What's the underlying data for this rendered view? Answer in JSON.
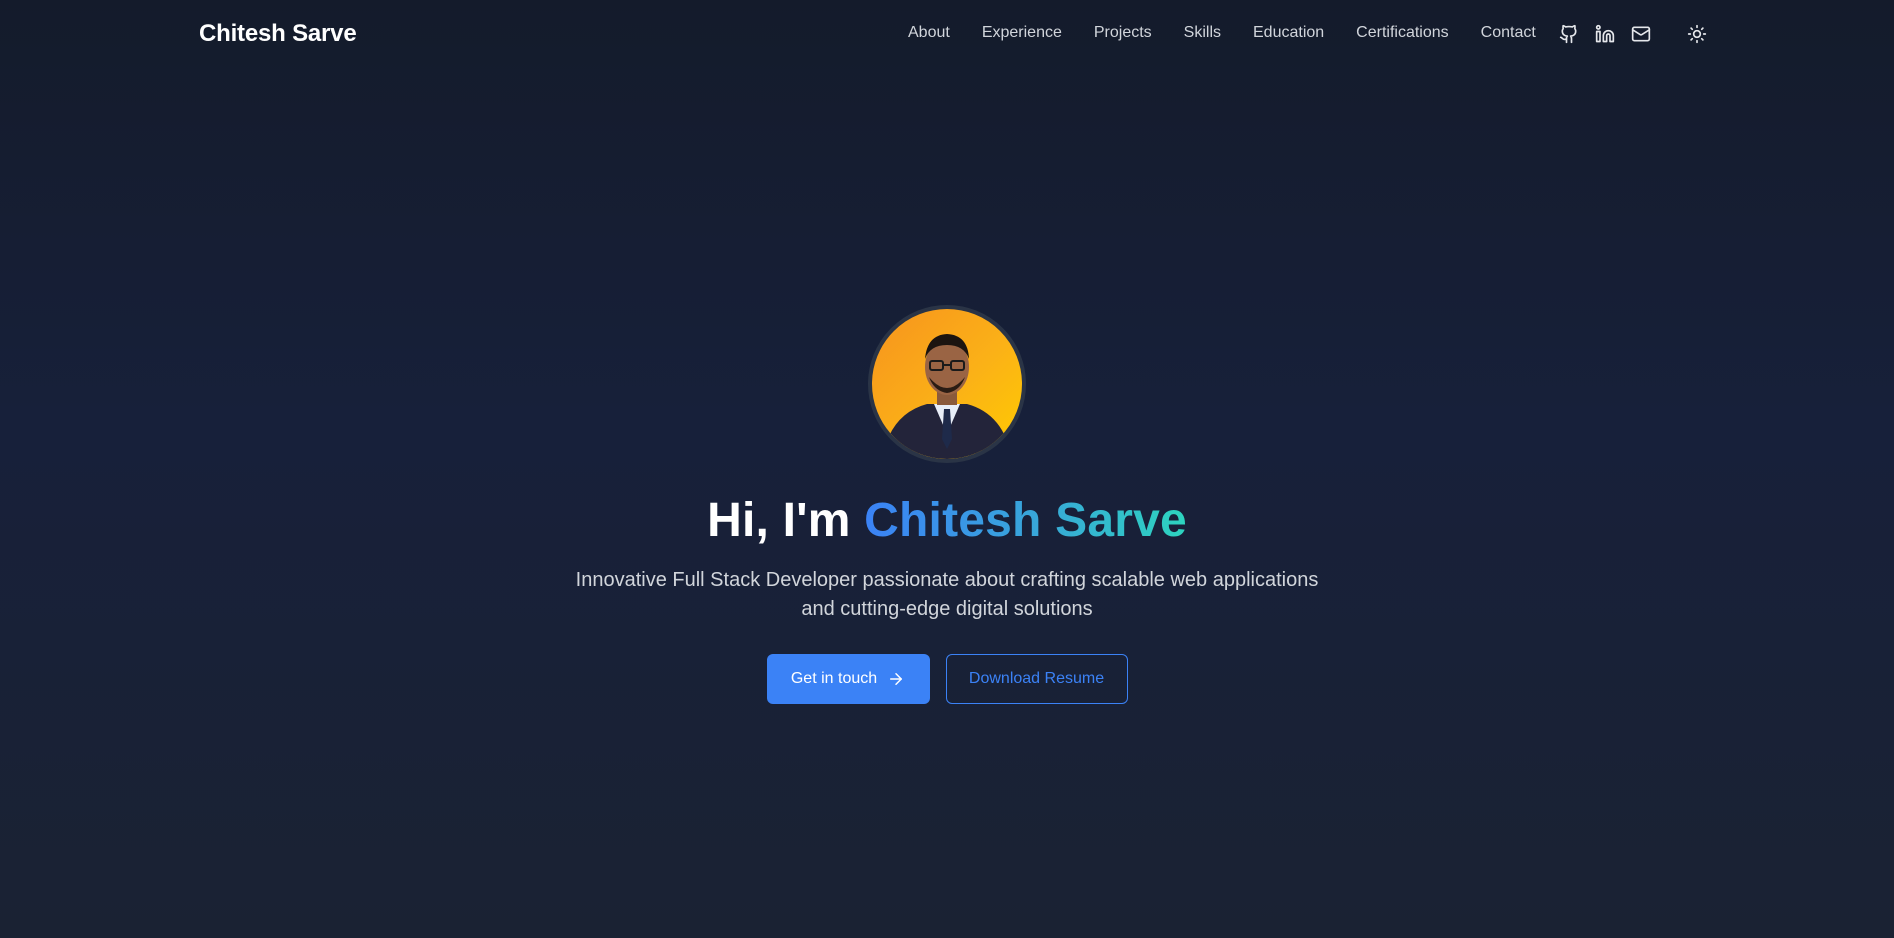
{
  "header": {
    "brand": "Chitesh Sarve",
    "nav": [
      {
        "label": "About"
      },
      {
        "label": "Experience"
      },
      {
        "label": "Projects"
      },
      {
        "label": "Skills"
      },
      {
        "label": "Education"
      },
      {
        "label": "Certifications"
      },
      {
        "label": "Contact"
      }
    ],
    "icons": [
      "github-icon",
      "linkedin-icon",
      "mail-icon",
      "sun-icon"
    ]
  },
  "hero": {
    "greeting": "Hi, I'm",
    "name": "Chitesh Sarve",
    "subtitle": "Innovative Full Stack Developer passionate about crafting scalable web applications and cutting-edge digital solutions",
    "primary_button": "Get in touch",
    "secondary_button": "Download Resume"
  },
  "colors": {
    "background": "#141b2b",
    "accent": "#3b82f6",
    "gradient_end": "#2dd4bf",
    "avatar_bg": "#fbb117"
  }
}
